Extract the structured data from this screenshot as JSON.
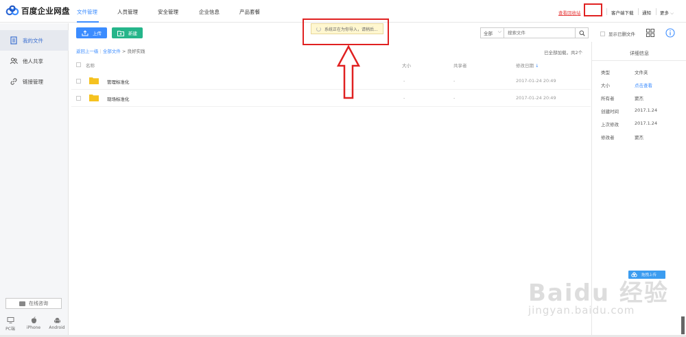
{
  "app": {
    "logo_text": "百度企业网盘",
    "logo_icon": "baidu-cloud-logo-icon",
    "accent_color": "#3b8cff",
    "new_button_color": "#25b58a",
    "highlight_color": "#e02020"
  },
  "top_nav": {
    "items": [
      {
        "label": "文件管理",
        "active": true
      },
      {
        "label": "人员管理",
        "active": false
      },
      {
        "label": "安全管理",
        "active": false
      },
      {
        "label": "企业信息",
        "active": false
      },
      {
        "label": "产品套餐",
        "active": false
      }
    ]
  },
  "top_right": {
    "recycle_label": "查看回收站",
    "client_download_label": "客户端下载",
    "notify_label": "通知",
    "more_label": "更多"
  },
  "sidebar": {
    "items": [
      {
        "label": "我的文件",
        "icon": "document-icon",
        "active": true
      },
      {
        "label": "他人共享",
        "icon": "people-icon",
        "active": false
      },
      {
        "label": "链接管理",
        "icon": "link-icon",
        "active": false
      }
    ],
    "chat_label": "在线咨询",
    "devices": [
      {
        "label": "PC端",
        "icon": "monitor-icon"
      },
      {
        "label": "iPhone",
        "icon": "apple-icon"
      },
      {
        "label": "Android",
        "icon": "android-icon"
      }
    ]
  },
  "toolbar": {
    "upload_label": "上传",
    "new_label": "新建",
    "toast_text": "系统正在为你导入，请稍后...",
    "scope_value": "全部",
    "search_placeholder": "搜索文件",
    "show_deleted_label": "显示已删文件"
  },
  "breadcrumb": {
    "back": "返回上一级",
    "all": "全部文件",
    "sep": ">",
    "current": "良好实践",
    "loaded_text": "已全部加载，共2个"
  },
  "table": {
    "headers": {
      "name": "名称",
      "size": "大小",
      "sharer": "共享者",
      "date": "修改日期"
    },
    "sort_indicator": "↓",
    "rows": [
      {
        "name": "管理标准化",
        "size": "-",
        "sharer": "-",
        "date": "2017-01-24 20:49"
      },
      {
        "name": "现场标准化",
        "size": "-",
        "sharer": "-",
        "date": "2017-01-24 20:49"
      }
    ]
  },
  "detail": {
    "title": "详细信息",
    "rows": [
      {
        "key": "类型",
        "value": "文件夹",
        "link": false
      },
      {
        "key": "大小",
        "value": "点击查看",
        "link": true
      },
      {
        "key": "所有者",
        "value": "窦杰",
        "link": false
      },
      {
        "key": "创建时间",
        "value": "2017.1.24",
        "link": false
      },
      {
        "key": "上次修改",
        "value": "2017.1.24",
        "link": false
      },
      {
        "key": "修改者",
        "value": "窦杰",
        "link": false
      }
    ],
    "drag_upload_label": "拖拽上传"
  },
  "watermark": {
    "brand": "Baidu 经验",
    "url": "jingyan.baidu.com"
  }
}
